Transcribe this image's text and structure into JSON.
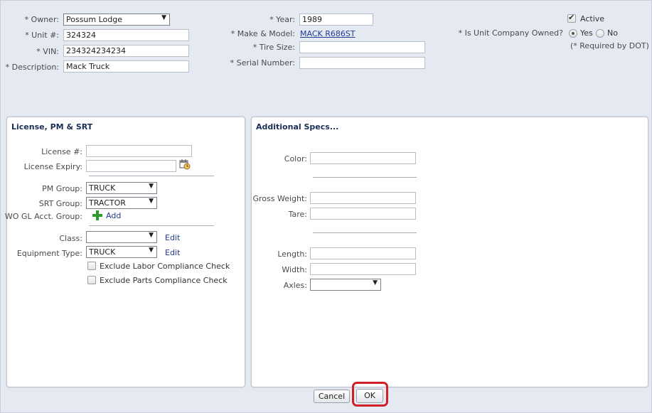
{
  "header": {
    "owner": {
      "label": "* Owner:",
      "value": "Possum Lodge"
    },
    "unit": {
      "label": "* Unit #:",
      "value": "324324"
    },
    "vin": {
      "label": "* VIN:",
      "value": "234324234234"
    },
    "description": {
      "label": "* Description:",
      "value": "Mack Truck"
    },
    "year": {
      "label": "* Year:",
      "value": "1989"
    },
    "make_model": {
      "label": "* Make & Model:",
      "value": "MACK R686ST"
    },
    "tire_size": {
      "label": "* Tire Size:",
      "value": ""
    },
    "serial_number": {
      "label": "* Serial Number:",
      "value": ""
    },
    "active": {
      "label": "Active",
      "checked": true
    },
    "company_owned": {
      "label": "* Is Unit Company Owned?",
      "yes": "Yes",
      "no": "No",
      "selected": "Yes"
    },
    "dot_note": "(* Required by DOT)"
  },
  "license_panel": {
    "title": "License, PM & SRT",
    "license_no": {
      "label": "License #:",
      "value": ""
    },
    "license_expiry": {
      "label": "License Expiry:",
      "value": ""
    },
    "pm_group": {
      "label": "PM Group:",
      "value": "TRUCK"
    },
    "srt_group": {
      "label": "SRT Group:",
      "value": "TRACTOR"
    },
    "wo_gl": {
      "label": "WO GL Acct. Group:",
      "add": "Add"
    },
    "class": {
      "label": "Class:",
      "value": "",
      "edit": "Edit"
    },
    "equipment_type": {
      "label": "Equipment Type:",
      "value": "TRUCK",
      "edit": "Edit"
    },
    "exclude_labor": {
      "label": "Exclude Labor Compliance Check",
      "checked": false
    },
    "exclude_parts": {
      "label": "Exclude Parts Compliance Check",
      "checked": false
    }
  },
  "specs_panel": {
    "title": "Additional Specs...",
    "color": {
      "label": "Color:",
      "value": ""
    },
    "gross_weight": {
      "label": "Gross Weight:",
      "value": ""
    },
    "tare": {
      "label": "Tare:",
      "value": ""
    },
    "length": {
      "label": "Length:",
      "value": ""
    },
    "width": {
      "label": "Width:",
      "value": ""
    },
    "axles": {
      "label": "Axles:",
      "value": ""
    }
  },
  "footer": {
    "cancel": "Cancel",
    "ok": "OK"
  },
  "colors": {
    "highlight": "#d11f26",
    "link": "#1f3a93",
    "background": "#e5e9f2"
  }
}
